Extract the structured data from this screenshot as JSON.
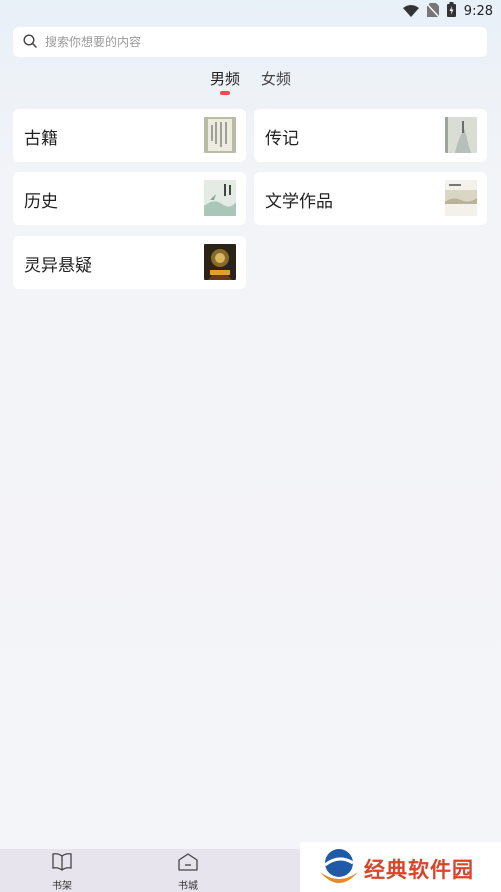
{
  "status_bar": {
    "time": "9:28"
  },
  "search": {
    "placeholder": "搜索你想要的内容"
  },
  "tabs": [
    {
      "label": "男频",
      "active": true
    },
    {
      "label": "女频",
      "active": false
    }
  ],
  "categories": [
    {
      "label": "古籍"
    },
    {
      "label": "传记"
    },
    {
      "label": "历史"
    },
    {
      "label": "文学作品"
    },
    {
      "label": "灵异悬疑"
    }
  ],
  "bottom_nav": [
    {
      "label": "书架",
      "icon": "book-open-icon"
    },
    {
      "label": "书城",
      "icon": "store-icon"
    }
  ],
  "watermark": {
    "text": "经典软件园"
  },
  "colors": {
    "accent": "#e85050",
    "watermark": "#d9442b"
  }
}
